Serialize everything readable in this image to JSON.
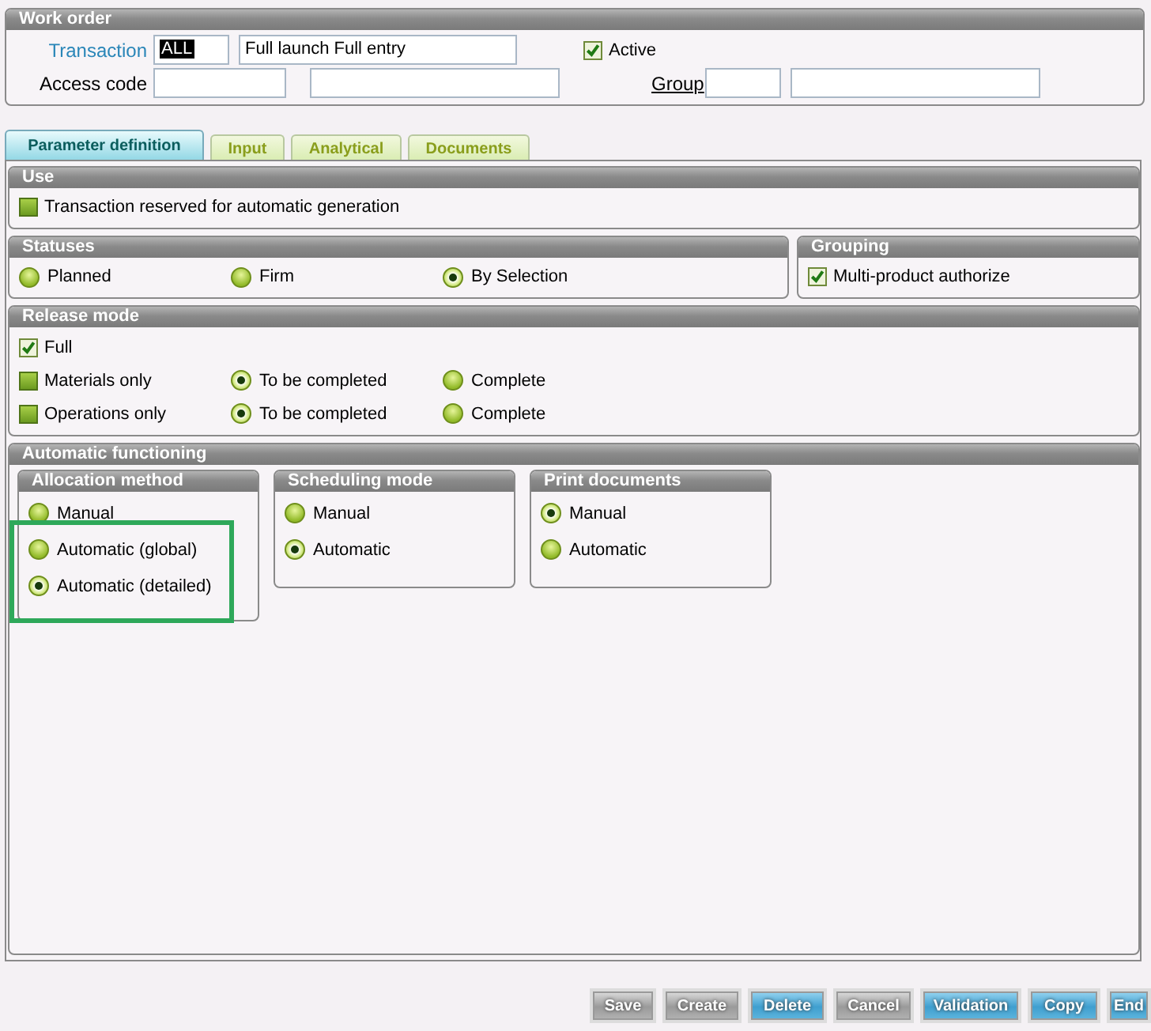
{
  "window": {
    "title": "Work order"
  },
  "header": {
    "transaction_label": "Transaction",
    "transaction_code": "ALL",
    "transaction_description": "Full launch Full entry",
    "active": {
      "label": "Active",
      "checked": true
    },
    "access_code_label": "Access code",
    "group_label": "Group"
  },
  "tabs": [
    {
      "label": "Parameter definition",
      "selected": true
    },
    {
      "label": "Input",
      "selected": false
    },
    {
      "label": "Analytical",
      "selected": false
    },
    {
      "label": "Documents",
      "selected": false
    }
  ],
  "use": {
    "title": "Use",
    "options": [
      {
        "label": "Transaction reserved for automatic generation",
        "checked": false
      }
    ]
  },
  "statuses": {
    "title": "Statuses",
    "options": [
      {
        "label": "Planned",
        "selected": false
      },
      {
        "label": "Firm",
        "selected": false
      },
      {
        "label": "By Selection",
        "selected": true
      }
    ]
  },
  "grouping": {
    "title": "Grouping",
    "options": [
      {
        "label": "Multi-product authorize",
        "checked": true
      }
    ]
  },
  "release_mode": {
    "title": "Release mode",
    "rows": [
      {
        "label": "Full",
        "checked": true
      },
      {
        "label": "Materials only",
        "checked": false,
        "choices": [
          {
            "label": "To be completed",
            "selected": true
          },
          {
            "label": "Complete",
            "selected": false
          }
        ]
      },
      {
        "label": "Operations only",
        "checked": false,
        "choices": [
          {
            "label": "To be completed",
            "selected": true
          },
          {
            "label": "Complete",
            "selected": false
          }
        ]
      }
    ]
  },
  "automatic_functioning": {
    "title": "Automatic functioning",
    "groups": [
      {
        "title": "Allocation method",
        "highlighted": true,
        "options": [
          {
            "label": "Manual",
            "selected": false
          },
          {
            "label": "Automatic (global)",
            "selected": false
          },
          {
            "label": "Automatic (detailed)",
            "selected": true
          }
        ]
      },
      {
        "title": "Scheduling mode",
        "highlighted": false,
        "options": [
          {
            "label": "Manual",
            "selected": false
          },
          {
            "label": "Automatic",
            "selected": true
          }
        ]
      },
      {
        "title": "Print documents",
        "highlighted": false,
        "options": [
          {
            "label": "Manual",
            "selected": true
          },
          {
            "label": "Automatic",
            "selected": false
          }
        ]
      }
    ]
  },
  "buttons": [
    {
      "label": "Save",
      "enabled": false
    },
    {
      "label": "Create",
      "enabled": false
    },
    {
      "label": "Delete",
      "enabled": true
    },
    {
      "label": "Cancel",
      "enabled": false
    },
    {
      "label": "Validation",
      "enabled": true
    },
    {
      "label": "Copy",
      "enabled": true
    },
    {
      "label": "End",
      "enabled": true
    }
  ]
}
